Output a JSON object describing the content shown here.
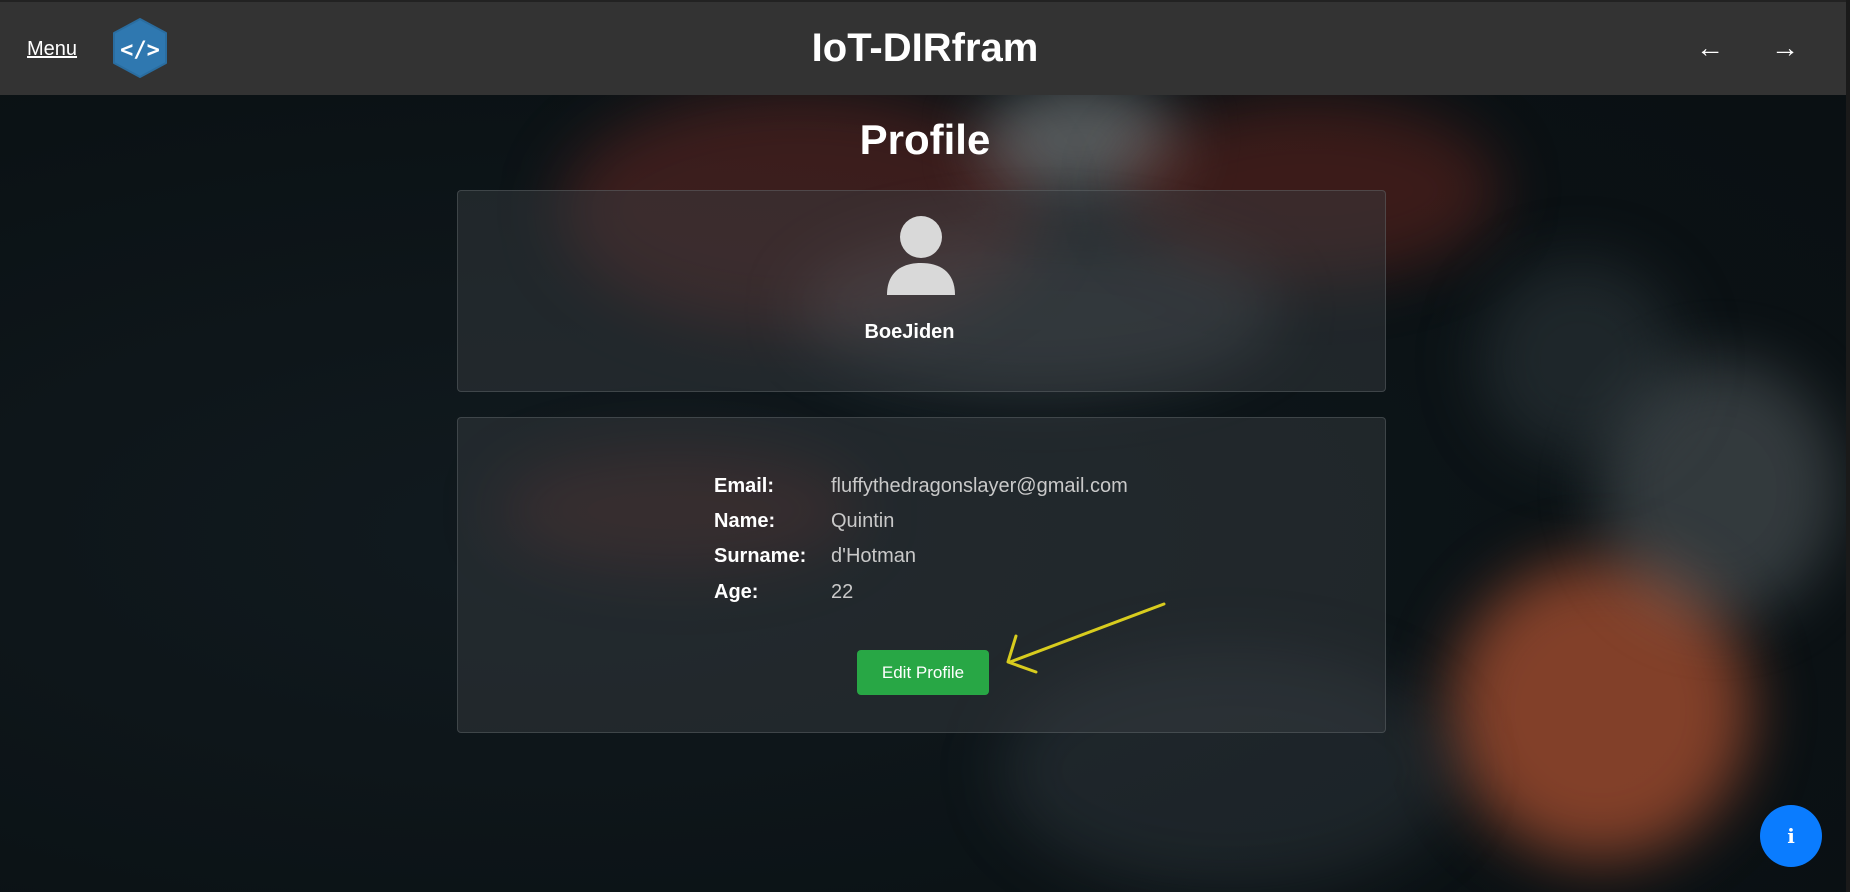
{
  "header": {
    "menu_label": "Menu",
    "logo_icon": "code-brackets-icon",
    "app_title": "IoT-DIRfram",
    "back_icon": "←",
    "forward_icon": "→"
  },
  "page": {
    "title": "Profile"
  },
  "profile": {
    "avatar_icon": "user-silhouette-icon",
    "username": "BoeJiden",
    "fields": [
      {
        "label": "Email:",
        "value": "fluffythedragonslayer@gmail.com"
      },
      {
        "label": "Name:",
        "value": "Quintin"
      },
      {
        "label": "Surname:",
        "value": "d'Hotman"
      },
      {
        "label": "Age:",
        "value": "22"
      }
    ],
    "edit_button_label": "Edit Profile"
  },
  "fab": {
    "info_label": "i"
  },
  "colors": {
    "topbar": "#333333",
    "accent_green": "#28a745",
    "logo_blue": "#2f78b0",
    "fab_blue": "#0a7cff",
    "annotation_yellow": "#d8cc1e"
  }
}
